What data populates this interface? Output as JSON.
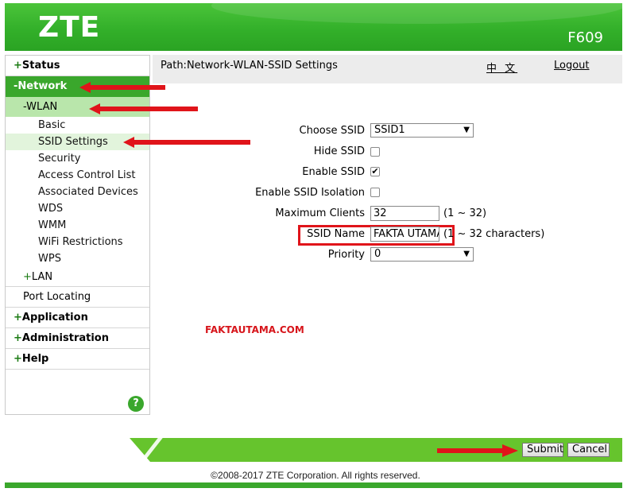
{
  "header": {
    "brand": "ZTE",
    "model": "F609"
  },
  "path": {
    "text": "Path:Network-WLAN-SSID Settings",
    "language": "中 文",
    "logout": "Logout"
  },
  "sidebar": {
    "status": "Status",
    "network": "Network",
    "wlan": "WLAN",
    "wlan_items": [
      "Basic",
      "SSID Settings",
      "Security",
      "Access Control List",
      "Associated Devices",
      "WDS",
      "WMM",
      "WiFi Restrictions",
      "WPS"
    ],
    "lan": "LAN",
    "port_locating": "Port Locating",
    "application": "Application",
    "administration": "Administration",
    "help": "Help",
    "plus": "+",
    "minus": "-",
    "help_icon": "?"
  },
  "form": {
    "choose_ssid_label": "Choose SSID",
    "choose_ssid_value": "SSID1",
    "hide_ssid_label": "Hide SSID",
    "hide_ssid_checked": false,
    "enable_ssid_label": "Enable SSID",
    "enable_ssid_checked": true,
    "enable_isolation_label": "Enable SSID Isolation",
    "enable_isolation_checked": false,
    "max_clients_label": "Maximum Clients",
    "max_clients_value": "32",
    "max_clients_hint": "(1 ~ 32)",
    "ssid_name_label": "SSID Name",
    "ssid_name_value": "FAKTA UTAMA",
    "ssid_name_hint": "(1 ~ 32 characters)",
    "priority_label": "Priority",
    "priority_value": "0"
  },
  "watermark": "FAKTAUTAMA.COM",
  "buttons": {
    "submit": "Submit",
    "cancel": "Cancel"
  },
  "copyright": "©2008-2017 ZTE Corporation. All rights reserved.",
  "colors": {
    "brand_green": "#3aa72c",
    "highlight_red": "#e0141a"
  },
  "icons": {
    "help": "help-icon",
    "dropdown": "chevron-down-icon",
    "annotation_arrow": "red-arrow-icon"
  }
}
